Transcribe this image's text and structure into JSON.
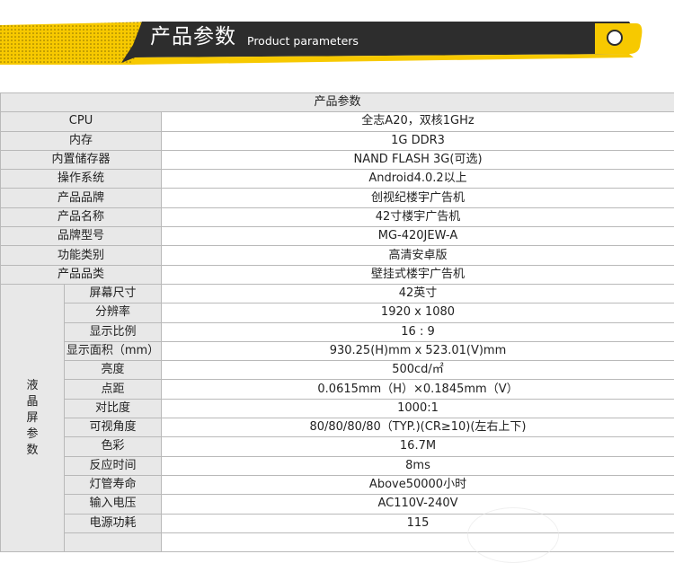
{
  "banner": {
    "title": "产品参数",
    "subtitle": "Product parameters"
  },
  "table": {
    "header": "产品参数",
    "rows": [
      {
        "label": "CPU",
        "value": "全志A20，双核1GHz"
      },
      {
        "label": "内存",
        "value": "1G  DDR3"
      },
      {
        "label": "内置储存器",
        "value": "NAND  FLASH  3G(可选)"
      },
      {
        "label": "操作系统",
        "value": "Android4.0.2以上"
      },
      {
        "label": "产品品牌",
        "value": "创视纪楼宇广告机"
      },
      {
        "label": "产品名称",
        "value": "42寸楼宇广告机"
      },
      {
        "label": "品牌型号",
        "value": "MG-420JEW-A"
      },
      {
        "label": "功能类别",
        "value": "高清安卓版"
      },
      {
        "label": "产品品类",
        "value": "壁挂式楼宇广告机"
      }
    ],
    "group": {
      "label": "液晶屏参数",
      "chars": [
        "液",
        "晶",
        "屏",
        "参",
        "数"
      ],
      "rows": [
        {
          "label": "屏幕尺寸",
          "value": "42英寸"
        },
        {
          "label": "分辨率",
          "value": "1920 x 1080"
        },
        {
          "label": "显示比例",
          "value": "16 : 9"
        },
        {
          "label": "显示面积（mm）",
          "value": "930.25(H)mm x 523.01(V)mm"
        },
        {
          "label": "亮度",
          "value": "500cd/㎡"
        },
        {
          "label": "点距",
          "value": "0.0615mm（H）×0.1845mm（V）"
        },
        {
          "label": "对比度",
          "value": "1000:1"
        },
        {
          "label": "可视角度",
          "value": "80/80/80/80（TYP.)(CR≥10)(左右上下)"
        },
        {
          "label": "色彩",
          "value": "16.7M"
        },
        {
          "label": "反应时间",
          "value": "8ms"
        },
        {
          "label": "灯管寿命",
          "value": "Above50000小时"
        },
        {
          "label": "输入电压",
          "value": "AC110V-240V"
        },
        {
          "label": "电源功耗",
          "value": "115"
        }
      ]
    }
  },
  "colors": {
    "banner_yellow": "#f7c900",
    "banner_dark": "#2d2d2d",
    "label_bg": "#e8e8e8",
    "border": "#b9b9b9"
  }
}
